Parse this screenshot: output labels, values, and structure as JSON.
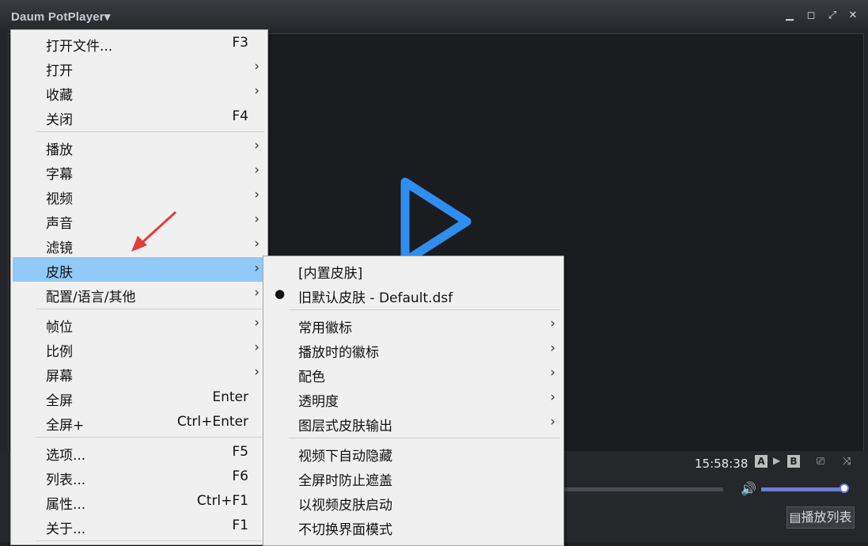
{
  "app_title": "Daum PotPlayer▾",
  "clock": "15:58:38",
  "ab_a": "A",
  "ab_b": "B",
  "playlist_button": "▤播放列表",
  "main_menu": [
    {
      "label": "打开文件...",
      "shortcut": "F3",
      "arrow": false
    },
    {
      "label": "打开",
      "shortcut": "",
      "arrow": true
    },
    {
      "label": "收藏",
      "shortcut": "",
      "arrow": true
    },
    {
      "label": "关闭",
      "shortcut": "F4",
      "arrow": false
    },
    {
      "label": "播放",
      "shortcut": "",
      "arrow": true
    },
    {
      "label": "字幕",
      "shortcut": "",
      "arrow": true
    },
    {
      "label": "视频",
      "shortcut": "",
      "arrow": true
    },
    {
      "label": "声音",
      "shortcut": "",
      "arrow": true
    },
    {
      "label": "滤镜",
      "shortcut": "",
      "arrow": true
    },
    {
      "label": "皮肤",
      "shortcut": "",
      "arrow": true,
      "highlighted": true
    },
    {
      "label": "配置/语言/其他",
      "shortcut": "",
      "arrow": true
    },
    {
      "label": "帧位",
      "shortcut": "",
      "arrow": true
    },
    {
      "label": "比例",
      "shortcut": "",
      "arrow": true
    },
    {
      "label": "屏幕",
      "shortcut": "",
      "arrow": true
    },
    {
      "label": "全屏",
      "shortcut": "Enter",
      "arrow": false
    },
    {
      "label": "全屏+",
      "shortcut": "Ctrl+Enter",
      "arrow": false
    },
    {
      "label": "选项...",
      "shortcut": "F5",
      "arrow": false
    },
    {
      "label": "列表...",
      "shortcut": "F6",
      "arrow": false
    },
    {
      "label": "属性...",
      "shortcut": "Ctrl+F1",
      "arrow": false
    },
    {
      "label": "关于...",
      "shortcut": "F1",
      "arrow": false
    }
  ],
  "skin_submenu": [
    {
      "label": "[内置皮肤]",
      "arrow": false,
      "checked": false
    },
    {
      "label": "旧默认皮肤 - Default.dsf",
      "arrow": false,
      "checked": true
    },
    {
      "label": "常用徽标",
      "arrow": true,
      "checked": false
    },
    {
      "label": "播放时的徽标",
      "arrow": true,
      "checked": false
    },
    {
      "label": "配色",
      "arrow": true,
      "checked": false
    },
    {
      "label": "透明度",
      "arrow": true,
      "checked": false
    },
    {
      "label": "图层式皮肤输出",
      "arrow": true,
      "checked": false
    },
    {
      "label": "视频下自动隐藏",
      "arrow": false,
      "checked": false
    },
    {
      "label": "全屏时防止遮盖",
      "arrow": false,
      "checked": false
    },
    {
      "label": "以视频皮肤启动",
      "arrow": false,
      "checked": false
    },
    {
      "label": "不切换界面模式",
      "arrow": false,
      "checked": false
    }
  ],
  "arrow_glyph": "›",
  "check_glyph": "●"
}
